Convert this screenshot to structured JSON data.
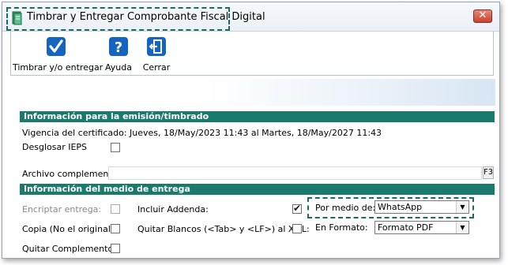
{
  "window": {
    "title": "Timbrar y Entregar Comprobante Fiscal Digital",
    "close_glyph": "✕"
  },
  "toolbar": {
    "buttons": [
      {
        "label": "Timbrar y/o entregar",
        "icon": "checkmark-icon"
      },
      {
        "label": "Ayuda",
        "icon": "help-icon"
      },
      {
        "label": "Cerrar",
        "icon": "exit-door-icon"
      }
    ]
  },
  "emision": {
    "header": "Información para la emisión/timbrado",
    "vigencia": "Vigencia del certificado: Jueves, 18/May/2023 11:43 al Martes, 18/May/2027 11:43",
    "desglosar_ieps_label": "Desglosar IEPS",
    "desglosar_ieps_checked": false,
    "archivo_label": "Archivo complemento:",
    "archivo_value": "",
    "f3_label": "F3"
  },
  "entrega": {
    "header": "Información del medio de entrega",
    "encriptar_label": "Encriptar entrega:",
    "encriptar_checked": false,
    "copia_label": "Copia (No el original):",
    "copia_checked": false,
    "quitar_complemento_label": "Quitar Complemento:",
    "quitar_complemento_checked": false,
    "incluir_addenda_label": "Incluir Addenda:",
    "incluir_addenda_checked": true,
    "quitar_blancos_label": "Quitar Blancos (<Tab> y <LF>) al  XML:",
    "quitar_blancos_checked": false,
    "por_medio_label": "Por medio de:",
    "por_medio_value": "WhatsApp",
    "formato_label": "En Formato:",
    "formato_value": "Formato PDF"
  },
  "colors": {
    "section_header": "#1a7a6d",
    "highlight_border": "#1a6b63",
    "toolbar_icon": "#1565c0"
  }
}
